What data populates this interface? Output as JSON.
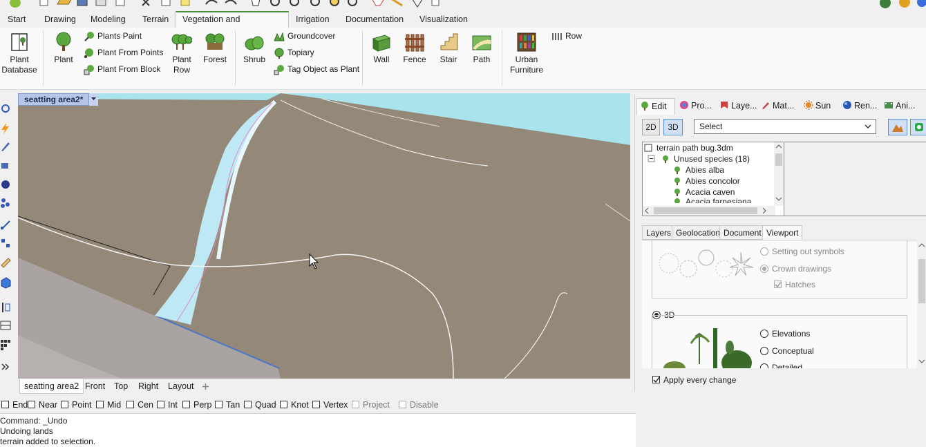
{
  "colors": {
    "accent_green": "#4a8f3a",
    "viewport_terrain": "#948878",
    "sky": "#a9e3ec",
    "path_cyan": "#bfe8f5",
    "viewport_title_bg": "#b7c6e8"
  },
  "menu_tabs": [
    "Start",
    "Drawing",
    "Modeling",
    "Terrain",
    "Vegetation and Hardscape",
    "Irrigation",
    "Documentation",
    "Visualization"
  ],
  "active_menu_tab": "Vegetation and Hardscape",
  "ribbon": {
    "plant_database": "Plant\nDatabase",
    "plant": "Plant",
    "plants_paint": "Plants Paint",
    "plant_from_points": "Plant From Points",
    "plant_from_block": "Plant From Block",
    "plant_row": "Plant\nRow",
    "forest": "Forest",
    "shrub": "Shrub",
    "groundcover": "Groundcover",
    "topiary": "Topiary",
    "tag_object_as_plant": "Tag Object as Plant",
    "wall": "Wall",
    "fence": "Fence",
    "stair": "Stair",
    "path": "Path",
    "urban_furniture": "Urban\nFurniture",
    "row": "Row"
  },
  "viewport": {
    "title": "seatting area2*"
  },
  "viewport_tabs": [
    "seatting area2",
    "Front",
    "Top",
    "Right",
    "Layout"
  ],
  "add_tab_icon": "plus-icon",
  "osnaps": [
    {
      "label": "End",
      "checked": false,
      "enabled": true
    },
    {
      "label": "Near",
      "checked": false,
      "enabled": true
    },
    {
      "label": "Point",
      "checked": false,
      "enabled": true
    },
    {
      "label": "Mid",
      "checked": false,
      "enabled": true
    },
    {
      "label": "Cen",
      "checked": false,
      "enabled": true
    },
    {
      "label": "Int",
      "checked": false,
      "enabled": true
    },
    {
      "label": "Perp",
      "checked": false,
      "enabled": true
    },
    {
      "label": "Tan",
      "checked": false,
      "enabled": true
    },
    {
      "label": "Quad",
      "checked": false,
      "enabled": true
    },
    {
      "label": "Knot",
      "checked": false,
      "enabled": true
    },
    {
      "label": "Vertex",
      "checked": false,
      "enabled": true
    },
    {
      "label": "Project",
      "checked": false,
      "enabled": false
    },
    {
      "label": "Disable",
      "checked": false,
      "enabled": false
    }
  ],
  "command_lines": [
    "Command: _Undo",
    "Undoing lands",
    " terrain added to selection."
  ],
  "panel": {
    "tabs": [
      "Edit",
      "Pro...",
      "Laye...",
      "Mat...",
      "Sun",
      "Ren...",
      "Ani..."
    ],
    "active_tab": "Edit",
    "btn_2d": "2D",
    "btn_3d": "3D",
    "select_value": "Select",
    "tree": {
      "root": "terrain path bug.3dm",
      "group": "Unused species (18)",
      "items": [
        "Abies alba",
        "Abies concolor",
        "Acacia caven",
        "Acacia farnesiana"
      ]
    },
    "subtabs": [
      "Layers",
      "Geolocation",
      "Document",
      "Viewport"
    ],
    "active_subtab": "Viewport",
    "viewport_options": {
      "setting_out_symbols": "Setting out symbols",
      "crown_drawings": "Crown drawings",
      "hatches": "Hatches",
      "mode_3d": "3D",
      "elevations": "Elevations",
      "conceptual": "Conceptual",
      "detailed": "Detailed"
    },
    "apply_every_change": "Apply every change"
  }
}
